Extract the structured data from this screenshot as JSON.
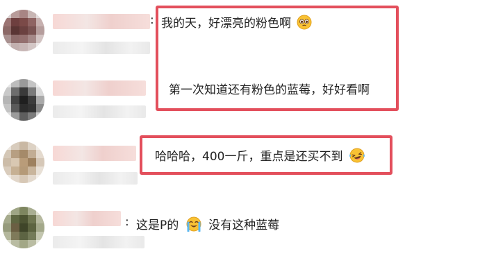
{
  "comments": [
    {
      "separator": ":",
      "text": "我的天，好漂亮的粉色啊",
      "emoji": "pleading-face-emoji"
    },
    {
      "text": "第一次知道还有粉色的蓝莓，好好看啊"
    },
    {
      "text": "哈哈哈，400一斤，重点是还买不到",
      "emoji": "laughing-face-emoji"
    },
    {
      "separator": ":",
      "text_before": "这是P的",
      "emoji": "loudly-crying-face-emoji",
      "text_after": "没有这种蓝莓"
    }
  ],
  "colors": {
    "highlight_border": "#e34f5c",
    "emoji_face": "#f9c234"
  }
}
